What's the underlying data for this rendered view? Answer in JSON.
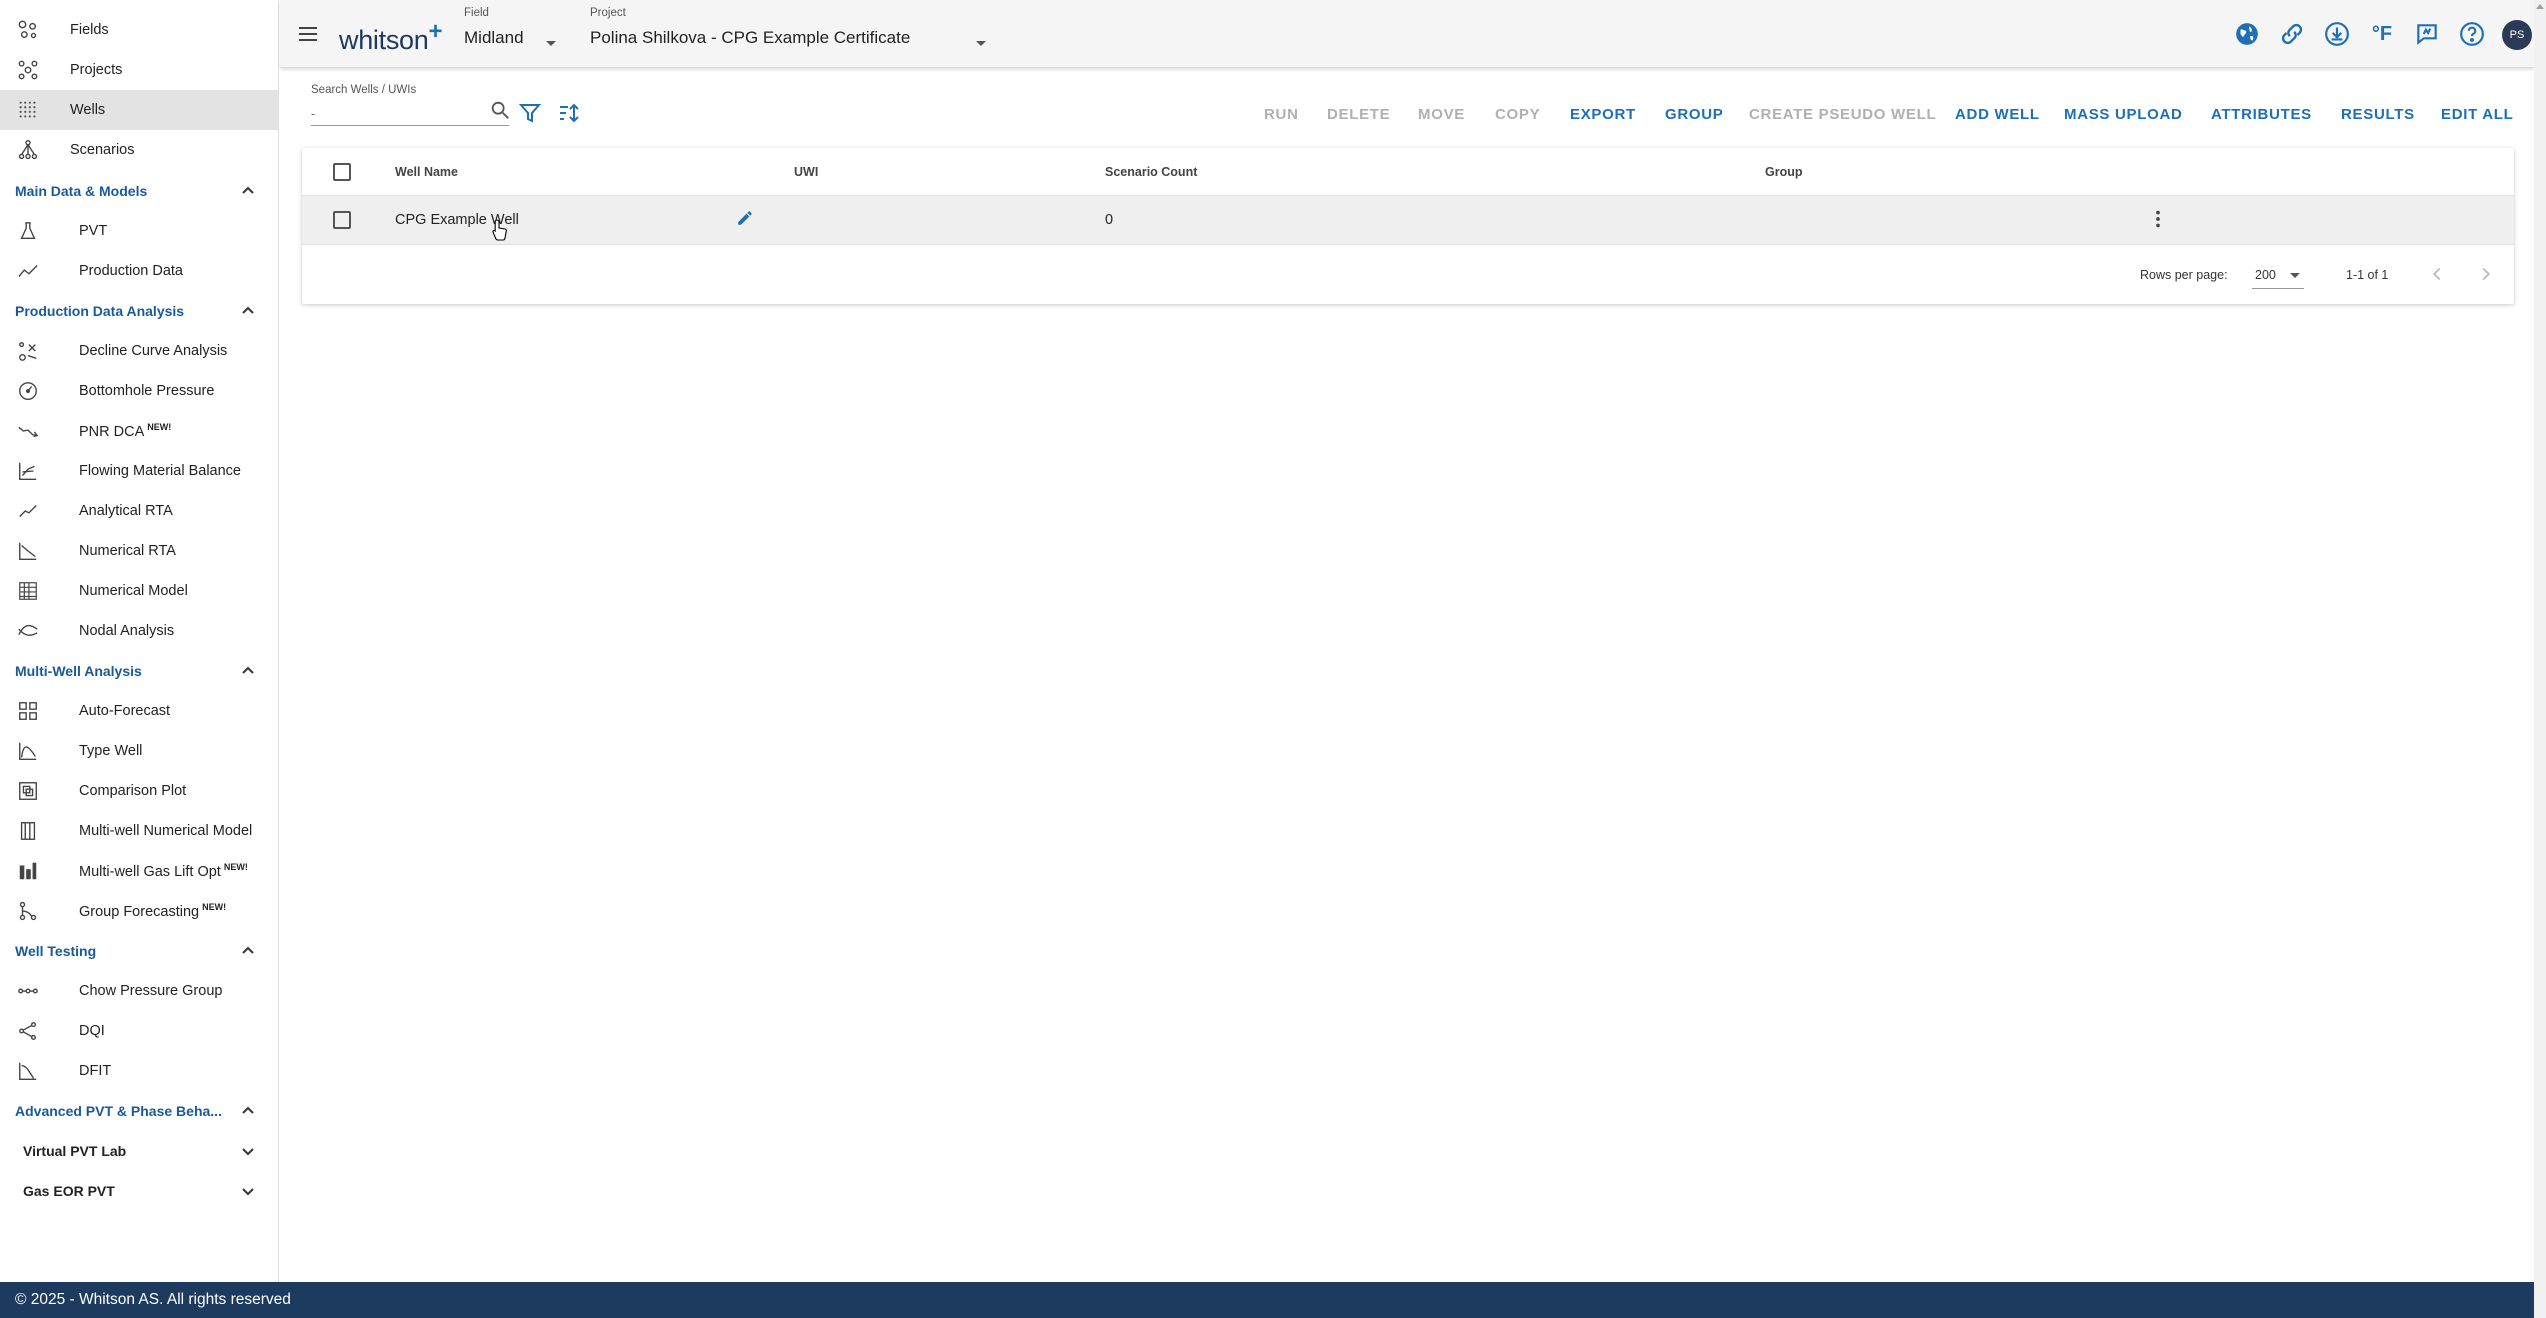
{
  "sidebar": {
    "top_items": [
      {
        "label": "Fields",
        "icon": "fields-icon"
      },
      {
        "label": "Projects",
        "icon": "projects-icon"
      },
      {
        "label": "Wells",
        "icon": "wells-icon",
        "active": true
      },
      {
        "label": "Scenarios",
        "icon": "scenarios-icon"
      }
    ],
    "sections": [
      {
        "label": "Main Data & Models",
        "items": [
          {
            "label": "PVT",
            "icon": "flask-icon"
          },
          {
            "label": "Production Data",
            "icon": "trend-icon"
          }
        ]
      },
      {
        "label": "Production Data Analysis",
        "items": [
          {
            "label": "Decline Curve Analysis",
            "icon": "dca-icon"
          },
          {
            "label": "Bottomhole Pressure",
            "icon": "gauge-icon"
          },
          {
            "label": "PNR DCA",
            "icon": "pnr-icon",
            "badge": "NEW!"
          },
          {
            "label": "Flowing Material Balance",
            "icon": "fmb-icon"
          },
          {
            "label": "Analytical RTA",
            "icon": "rta-icon"
          },
          {
            "label": "Numerical RTA",
            "icon": "numrta-icon"
          },
          {
            "label": "Numerical Model",
            "icon": "grid-model-icon"
          },
          {
            "label": "Nodal Analysis",
            "icon": "nodal-icon"
          }
        ]
      },
      {
        "label": "Multi-Well Analysis",
        "items": [
          {
            "label": "Auto-Forecast",
            "icon": "auto-forecast-icon"
          },
          {
            "label": "Type Well",
            "icon": "type-well-icon"
          },
          {
            "label": "Comparison Plot",
            "icon": "comparison-icon"
          },
          {
            "label": "Multi-well Numerical Model",
            "icon": "multiwell-model-icon"
          },
          {
            "label": "Multi-well Gas Lift Opt",
            "icon": "gas-lift-icon",
            "badge": "NEW!"
          },
          {
            "label": "Group Forecasting",
            "icon": "group-forecast-icon",
            "badge": "NEW!"
          }
        ]
      },
      {
        "label": "Well Testing",
        "items": [
          {
            "label": "Chow Pressure Group",
            "icon": "chow-icon"
          },
          {
            "label": "DQI",
            "icon": "dqi-icon"
          },
          {
            "label": "DFIT",
            "icon": "dfit-icon"
          }
        ]
      },
      {
        "label": "Advanced PVT & Phase Beha...",
        "items": []
      }
    ],
    "collapsibles": [
      {
        "label": "Virtual PVT Lab"
      },
      {
        "label": "Gas EOR PVT"
      }
    ]
  },
  "header": {
    "logo": "whitson",
    "logo_plus": "+",
    "field_caption": "Field",
    "field_value": "Midland",
    "project_caption": "Project",
    "project_value": "Polina Shilkova - CPG Example Certificate",
    "avatar_initials": "PS",
    "unit_label": "°F"
  },
  "toolbar": {
    "search_caption": "Search Wells / UWIs",
    "search_placeholder": "-",
    "actions": [
      {
        "label": "RUN",
        "enabled": false
      },
      {
        "label": "DELETE",
        "enabled": false
      },
      {
        "label": "MOVE",
        "enabled": false
      },
      {
        "label": "COPY",
        "enabled": false
      },
      {
        "label": "EXPORT",
        "enabled": true
      },
      {
        "label": "GROUP",
        "enabled": true
      },
      {
        "label": "CREATE PSEUDO WELL",
        "enabled": false
      },
      {
        "label": "ADD WELL",
        "enabled": true
      },
      {
        "label": "MASS UPLOAD",
        "enabled": true
      },
      {
        "label": "ATTRIBUTES",
        "enabled": true
      },
      {
        "label": "RESULTS",
        "enabled": true
      },
      {
        "label": "EDIT ALL",
        "enabled": true
      }
    ]
  },
  "table": {
    "columns": [
      "Well Name",
      "UWI",
      "Scenario Count",
      "Group"
    ],
    "rows": [
      {
        "well_name": "CPG Example Well",
        "uwi": "",
        "scenario_count": "0",
        "group": ""
      }
    ],
    "rows_per_page_label": "Rows per page:",
    "rows_per_page": "200",
    "range": "1-1 of 1"
  },
  "footer": {
    "copyright": "© 2025 - Whitson AS. All rights reserved"
  },
  "colors": {
    "primary": "#1f6fb5",
    "section": "#1a5a99",
    "footer_bg": "#1d3a5f",
    "active_bg": "#e3e3e3",
    "disabled": "#b0b0b0"
  }
}
